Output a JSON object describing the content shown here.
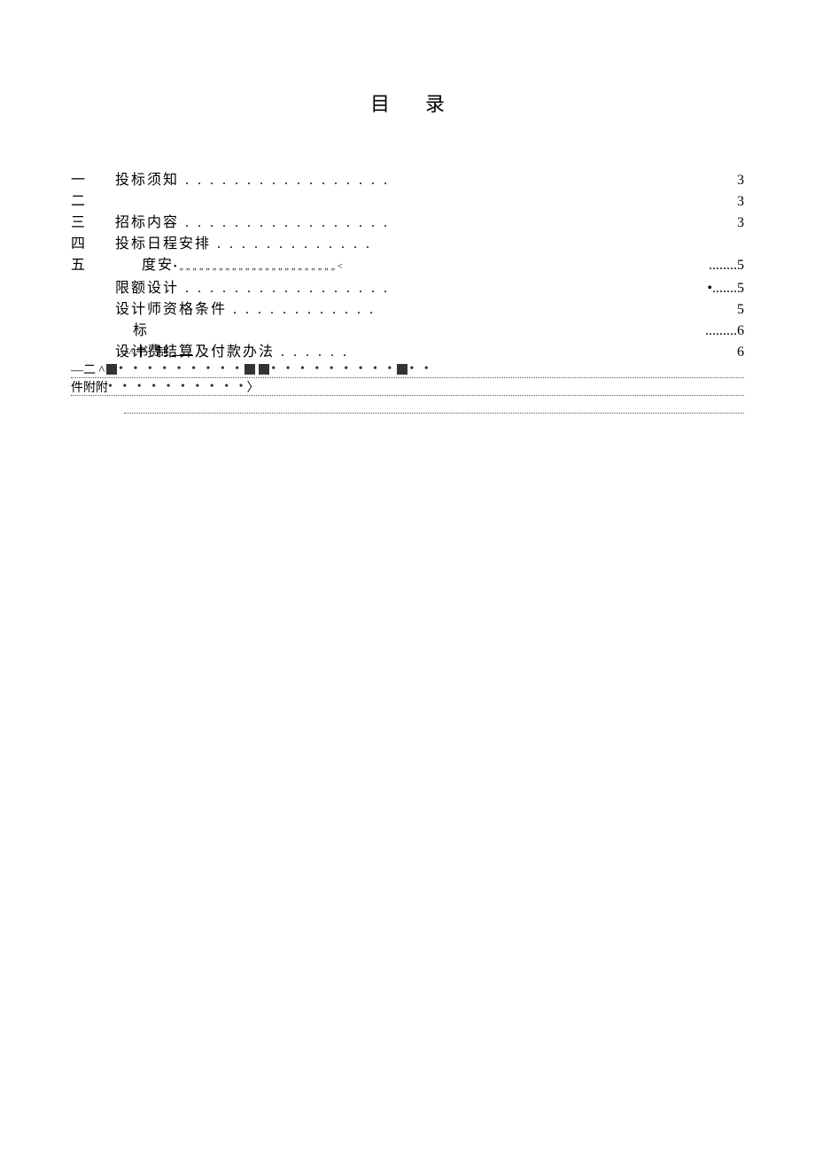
{
  "title": "目录",
  "numbers": [
    "一",
    "二",
    "三",
    "四",
    "五"
  ],
  "toc": [
    {
      "label": "投标须知",
      "dots": " . . . . . . . . . . . . . . . . .",
      "page": "3",
      "indent": ""
    },
    {
      "label": "",
      "dots": "",
      "page": "3",
      "indent": ""
    },
    {
      "label": "招标内容",
      "dots": " . . . . . . . . . . . . . . . . .",
      "page": "3",
      "indent": ""
    },
    {
      "label": "投标日程安排",
      "dots": " . . . . . . . . . . . . .",
      "page": "",
      "indent": ""
    },
    {
      "label": "度安",
      "dots": "•„„„„„„„„„„„„„„„„„„„„„„„„<",
      "page": "........5",
      "indent": "indent1"
    },
    {
      "label": "限额设计",
      "dots": " . . . . . . . . . . . . . . . . .",
      "page": "•.......5",
      "indent": ""
    },
    {
      "label": "设计师资格条件",
      "dots": " . . . . . . . . . . . .",
      "page": "5",
      "indent": ""
    },
    {
      "label": "标",
      "dots": "",
      "page": ".........6",
      "indent": "indent2"
    },
    {
      "label": "设计费结算及付款办法",
      "dots": " . . . . . .",
      "page": "6",
      "indent": ""
    }
  ],
  "aboveLine": {
    "caret": "^^",
    "text1": "书",
    "mid": "„",
    "text2": "制"
  },
  "footer": {
    "row1_prefix": "—二 ^",
    "row1_bullets": "• •",
    "row2_prefix": "件附附",
    "row2_arrow": "〉"
  }
}
